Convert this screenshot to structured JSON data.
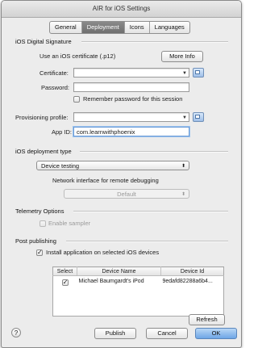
{
  "window": {
    "title": "AIR for iOS Settings"
  },
  "tabs": [
    {
      "label": "General"
    },
    {
      "label": "Deployment"
    },
    {
      "label": "Icons"
    },
    {
      "label": "Languages"
    }
  ],
  "active_tab": "Deployment",
  "signature": {
    "title": "iOS Digital Signature",
    "use_certificate_label": "Use an iOS certificate (.p12)",
    "more_info_label": "More Info",
    "certificate_label": "Certificate:",
    "certificate_value": "",
    "password_label": "Password:",
    "password_value": "",
    "remember_label": "Remember password for this session",
    "remember_checked": false,
    "provisioning_label": "Provisioning profile:",
    "provisioning_value": "",
    "app_id_label": "App ID:",
    "app_id_value": "com.learnwithphoenix"
  },
  "deployment": {
    "title": "iOS deployment type",
    "type_value": "Device testing",
    "network_label": "Network interface for remote debugging",
    "network_value": "Default"
  },
  "telemetry": {
    "title": "Telemetry Options",
    "enable_sampler_label": "Enable sampler",
    "enable_sampler_checked": false
  },
  "post_publishing": {
    "title": "Post publishing",
    "install_label": "Install application on selected iOS devices",
    "install_checked": true,
    "columns": [
      "Select",
      "Device Name",
      "Device Id"
    ],
    "devices": [
      {
        "selected": true,
        "name": "Michael Baumgardt's iPod",
        "id": "9edafd82288a6b4..."
      }
    ],
    "refresh_label": "Refresh"
  },
  "footer": {
    "help_label": "?",
    "publish_label": "Publish",
    "cancel_label": "Cancel",
    "ok_label": "OK"
  },
  "colors": {
    "accent": "#6ea6e6",
    "active_tab": "#777777",
    "window_bg": "#ececec"
  }
}
